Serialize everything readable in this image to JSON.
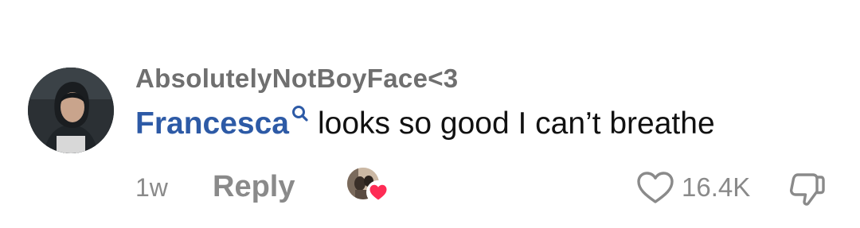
{
  "comment": {
    "username": "AbsolutelyNotBoyFace<3",
    "mention": "Francesca",
    "text": "looks so good I can’t breathe",
    "time": "1w",
    "reply_label": "Reply",
    "like_count": "16.4K",
    "icons": {
      "avatar": "user-avatar",
      "mention": "search-icon",
      "creator_like": "heart-icon",
      "like": "heart-outline-icon",
      "dislike": "thumbs-down-icon"
    },
    "colors": {
      "username": "#6f6f6f",
      "mention": "#2d5aa6",
      "meta": "#8a8a8a",
      "heart": "#fe2c55"
    }
  }
}
